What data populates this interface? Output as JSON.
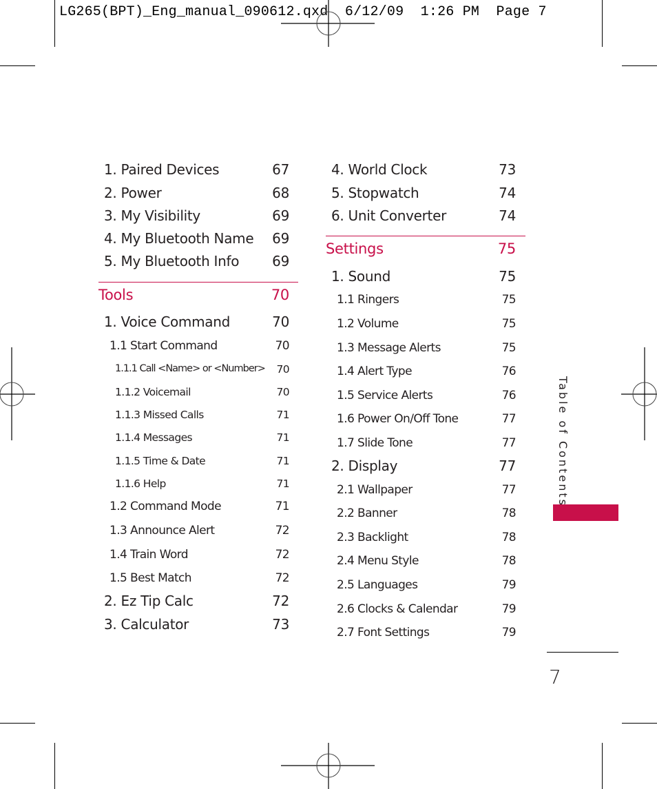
{
  "slug": "LG265(BPT)_Eng_manual_090612.qxd  6/12/09  1:26 PM  Page 7",
  "accent_color": "#c8104a",
  "left_column": {
    "entries_top": [
      {
        "title": "1. Paired Devices",
        "page": "67"
      },
      {
        "title": "2. Power",
        "page": "68"
      },
      {
        "title": "3. My Visibility",
        "page": "69"
      },
      {
        "title": "4. My Bluetooth Name",
        "page": "69"
      },
      {
        "title": "5. My Bluetooth Info",
        "page": "69"
      }
    ],
    "section": {
      "title": "Tools",
      "page": "70"
    },
    "entries": [
      {
        "title": "1. Voice Command",
        "page": "70"
      },
      {
        "title": "1.1 Start Command",
        "page": "70"
      },
      {
        "title": "1.1.1 Call <Name> or <Number>",
        "page": "70"
      },
      {
        "title": "1.1.2 Voicemail",
        "page": "70"
      },
      {
        "title": "1.1.3 Missed Calls",
        "page": "71"
      },
      {
        "title": "1.1.4 Messages",
        "page": "71"
      },
      {
        "title": "1.1.5 Time & Date",
        "page": "71"
      },
      {
        "title": "1.1.6 Help",
        "page": "71"
      },
      {
        "title": "1.2 Command Mode",
        "page": "71"
      },
      {
        "title": "1.3 Announce Alert",
        "page": "72"
      },
      {
        "title": "1.4 Train Word",
        "page": "72"
      },
      {
        "title": "1.5 Best Match",
        "page": "72"
      },
      {
        "title": "2. Ez Tip Calc",
        "page": "72"
      },
      {
        "title": "3. Calculator",
        "page": "73"
      }
    ]
  },
  "right_column": {
    "entries_top": [
      {
        "title": "4. World Clock",
        "page": "73"
      },
      {
        "title": "5. Stopwatch",
        "page": "74"
      },
      {
        "title": "6. Unit Converter",
        "page": "74"
      }
    ],
    "section": {
      "title": "Settings",
      "page": "75"
    },
    "entries": [
      {
        "title": "1. Sound",
        "page": "75"
      },
      {
        "title": "1.1 Ringers",
        "page": "75"
      },
      {
        "title": "1.2 Volume",
        "page": "75"
      },
      {
        "title": "1.3 Message Alerts",
        "page": "75"
      },
      {
        "title": "1.4 Alert Type",
        "page": "76"
      },
      {
        "title": "1.5 Service Alerts",
        "page": "76"
      },
      {
        "title": "1.6 Power On/Off Tone",
        "page": "77"
      },
      {
        "title": "1.7 Slide Tone",
        "page": "77"
      },
      {
        "title": "2. Display",
        "page": "77"
      },
      {
        "title": "2.1 Wallpaper",
        "page": "77"
      },
      {
        "title": "2.2 Banner",
        "page": "78"
      },
      {
        "title": "2.3 Backlight",
        "page": "78"
      },
      {
        "title": "2.4 Menu Style",
        "page": "78"
      },
      {
        "title": "2.5 Languages",
        "page": "79"
      },
      {
        "title": "2.6 Clocks & Calendar",
        "page": "79"
      },
      {
        "title": "2.7 Font Settings",
        "page": "79"
      }
    ]
  },
  "side_label": "Table of Contents",
  "page_number": "7"
}
